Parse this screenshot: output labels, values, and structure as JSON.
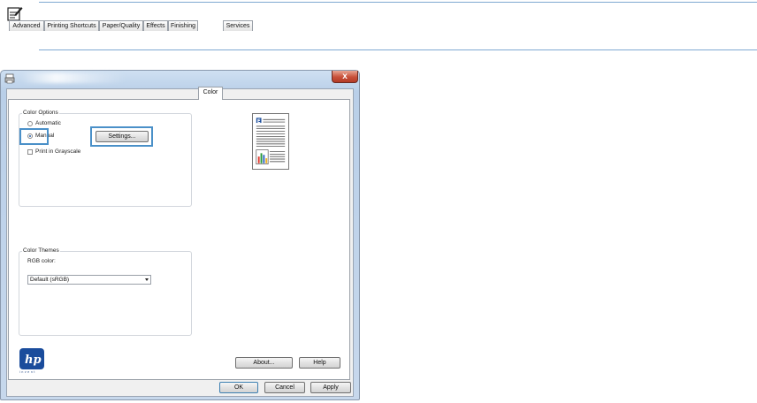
{
  "dialog": {
    "tabs": [
      "Advanced",
      "Printing Shortcuts",
      "Paper/Quality",
      "Effects",
      "Finishing",
      "Color",
      "Services"
    ],
    "active_tab": "Color",
    "color_options": {
      "legend": "Color Options",
      "automatic_label": "Automatic",
      "manual_label": "Manual",
      "manual_selected": true,
      "settings_button": "Settings...",
      "grayscale_label": "Print in Grayscale",
      "grayscale_checked": false
    },
    "color_themes": {
      "legend": "Color Themes",
      "rgb_label": "RGB color:",
      "rgb_value": "Default (sRGB)"
    },
    "buttons": {
      "about": "About...",
      "help": "Help",
      "ok": "OK",
      "cancel": "Cancel",
      "apply": "Apply",
      "close": "x"
    },
    "brand": {
      "logo_text": "hp",
      "logo_sub": "invent",
      "color": "#1a4c9c"
    },
    "accent": "#4a90c8"
  }
}
